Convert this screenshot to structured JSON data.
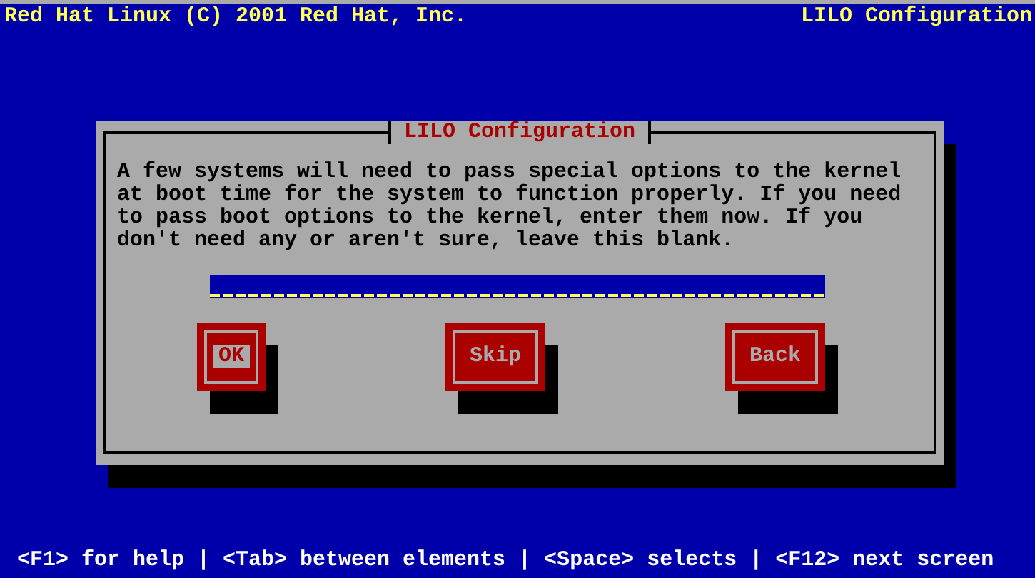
{
  "header": {
    "title": "Red Hat Linux (C) 2001 Red Hat, Inc.",
    "screen": "LILO Configuration"
  },
  "dialog": {
    "title": "LILO Configuration",
    "message": "A few systems will need to pass special options to the kernel at boot time for the system to function properly. If you need to pass boot options to the kernel, enter them now. If you don't need any or aren't sure, leave this blank.",
    "buttons": [
      {
        "label": "OK",
        "selected": true
      },
      {
        "label": "Skip",
        "selected": false
      },
      {
        "label": "Back",
        "selected": false
      }
    ]
  },
  "status_bar": "<F1> for help | <Tab> between elements | <Space> selects | <F12> next screen"
}
